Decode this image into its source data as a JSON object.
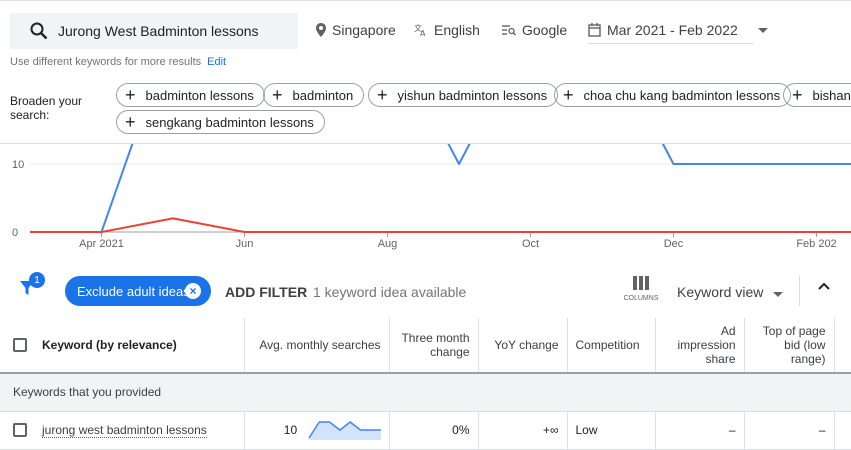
{
  "search": {
    "query": "Jurong West Badminton lessons"
  },
  "top": {
    "location": "Singapore",
    "language": "English",
    "network": "Google",
    "date_range": "Mar 2021 - Feb 2022"
  },
  "hint": {
    "text": "Use different keywords for more results",
    "edit": "Edit"
  },
  "broaden": {
    "label": "Broaden your search:",
    "chips": [
      "badminton lessons",
      "badminton",
      "yishun badminton lessons",
      "choa chu kang badminton lessons",
      "bishan b",
      "sengkang badminton lessons"
    ]
  },
  "chart_data": {
    "type": "line",
    "x_ticks": [
      "Apr 2021",
      "Jun",
      "Aug",
      "Oct",
      "Dec",
      "Feb 202"
    ],
    "y_ticks": [
      "10",
      "0"
    ],
    "ylim": [
      0,
      30
    ],
    "series": [
      {
        "color": "#4285f4",
        "x": [
          0,
          1,
          2,
          3,
          4,
          5,
          6,
          7,
          8,
          9,
          10,
          11,
          12
        ],
        "values": [
          0,
          0,
          30,
          30,
          30,
          30,
          10,
          30,
          30,
          10,
          10,
          10,
          10
        ]
      },
      {
        "color": "#ea4335",
        "x": [
          0,
          1,
          2,
          3,
          4,
          5,
          6,
          7,
          8,
          9,
          10,
          11,
          12
        ],
        "values": [
          0,
          0,
          2,
          0,
          0,
          0,
          0,
          0,
          0,
          0,
          0,
          0,
          0
        ]
      }
    ]
  },
  "filters": {
    "badge": "1",
    "exclude_chip": "Exclude adult ideas",
    "add_filter": "ADD FILTER",
    "idea_count": "1 keyword idea available",
    "columns": "COLUMNS",
    "keyword_view": "Keyword view"
  },
  "table": {
    "headers": [
      "Keyword (by relevance)",
      "Avg. monthly searches",
      "Three month change",
      "YoY change",
      "Competition",
      "Ad impression share",
      "Top of page bid (low range)"
    ],
    "section": "Keywords that you provided",
    "rows": [
      {
        "keyword": "jurong west badminton lessons",
        "avg": "10",
        "spark": [
          0,
          1,
          1,
          0.5,
          1,
          0.5,
          0.5,
          0.5
        ],
        "three_month": "0%",
        "yoy": "+∞",
        "competition": "Low",
        "impression": "–",
        "bid": "–"
      }
    ]
  }
}
